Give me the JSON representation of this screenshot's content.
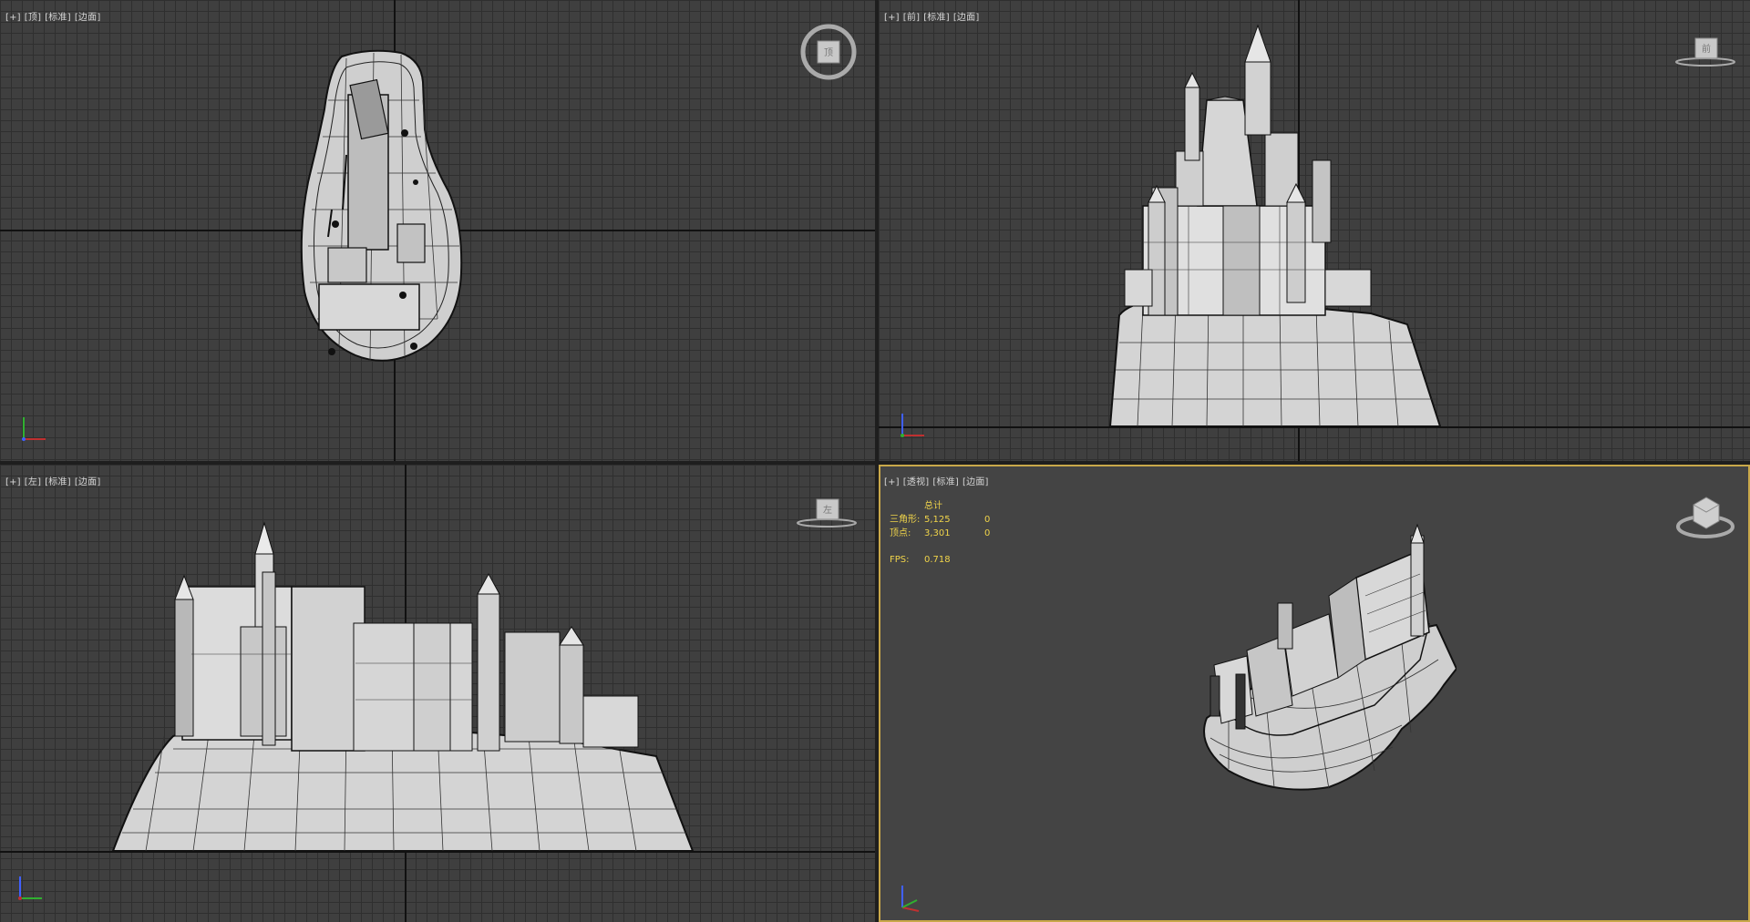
{
  "viewports": {
    "top": {
      "labels": [
        "[+]",
        "[顶]",
        "[标准]",
        "[边面]"
      ],
      "cube_face": "顶"
    },
    "front": {
      "labels": [
        "[+]",
        "[前]",
        "[标准]",
        "[边面]"
      ],
      "cube_face": "前"
    },
    "left": {
      "labels": [
        "[+]",
        "[左]",
        "[标准]",
        "[边面]"
      ],
      "cube_face": "左"
    },
    "perspective": {
      "labels": [
        "[+]",
        "[透视]",
        "[标准]",
        "[边面]"
      ],
      "active": true,
      "stats": {
        "header": "总计",
        "triangles_label": "三角形:",
        "triangles_value": "5,125",
        "triangles_sel": "0",
        "vertices_label": "顶点:",
        "vertices_value": "3,301",
        "vertices_sel": "0",
        "fps_label": "FPS:",
        "fps_value": "0.718"
      }
    }
  },
  "colors": {
    "grid_bg": "#3f3f3f",
    "grid_line": "#2f2f2f",
    "persp_bg": "#444444",
    "active_border": "#c9a84a",
    "stats_text": "#f0d44a",
    "model_fill": "#d0d0d0",
    "wire": "#1a1a1a"
  },
  "icons": [
    "viewcube-icon",
    "axis-gizmo-icon"
  ]
}
